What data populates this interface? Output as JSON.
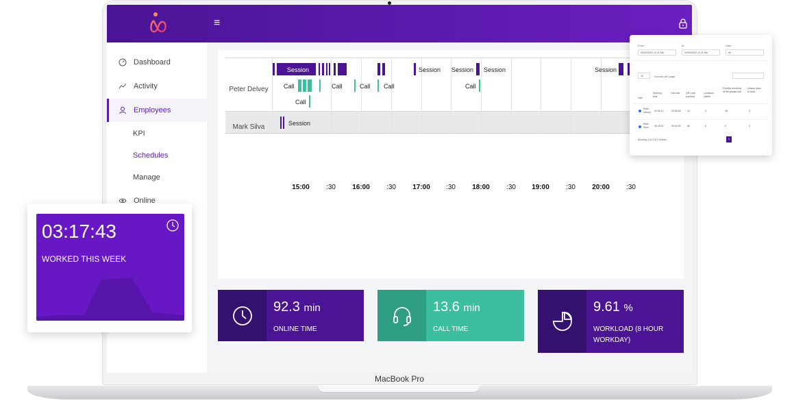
{
  "device": {
    "brand_label": "MacBook Pro"
  },
  "topbar": {
    "menu_glyph": "≡",
    "logo_icon": "logo-icon",
    "lock_icon": "lock-icon"
  },
  "sidebar": {
    "items": [
      {
        "label": "Dashboard",
        "icon": "gauge-icon"
      },
      {
        "label": "Activity",
        "icon": "trend-icon"
      },
      {
        "label": "Employees",
        "icon": "user-icon"
      },
      {
        "label": "Online",
        "icon": "eye-icon"
      }
    ],
    "sub_items": [
      {
        "label": "KPI"
      },
      {
        "label": "Schedules"
      },
      {
        "label": "Manage"
      }
    ]
  },
  "timeline": {
    "employees": [
      "Peter Delvey",
      "Mark Silva"
    ],
    "session_label": "Session",
    "call_label": "Call",
    "ticks": [
      "15:00",
      ":30",
      "16:00",
      ":30",
      "17:00",
      ":30",
      "18:00",
      ":30",
      "19:00",
      ":30",
      "20:00",
      ":30"
    ]
  },
  "stats": [
    {
      "value": "92.3",
      "unit": "min",
      "label": "ONLINE TIME",
      "icon": "clock-icon",
      "color": "#4a1495"
    },
    {
      "value": "13.6",
      "unit": "min",
      "label": "CALL TIME",
      "icon": "headset-icon",
      "color": "#3bbf9e"
    },
    {
      "value": "9.61",
      "unit": "%",
      "label": "WORKLOAD (8 HOUR WORKDAY)",
      "icon": "pie-icon",
      "color": "#4a1495"
    }
  ],
  "week_card": {
    "time": "03:17:43",
    "label": "WORKED THIS WEEK",
    "icon": "clock-icon"
  },
  "report": {
    "from_label": "From",
    "from_value": "04/02/2022 10:11 AM",
    "to_label": "to",
    "to_value": "04/09/2022 10:11 AM",
    "user_label": "User",
    "user_value": "All",
    "page_size": "10",
    "records_label": "records per page",
    "columns": [
      "User",
      "Working time",
      "Call time",
      "QR code scanned",
      "Locations visited",
      "Positive emotions of the people met",
      "Unique days of work"
    ],
    "rows": [
      {
        "user": "Peter Delvey",
        "working": "02:59:10",
        "call": "00:06:28",
        "qr": "12",
        "loc": "0",
        "pos": "28",
        "days": "5"
      },
      {
        "user": "Mark Silva",
        "working": "00:18:32",
        "call": "00:00:00",
        "qr": "65",
        "loc": "0",
        "pos": "0",
        "days": "3"
      }
    ],
    "footer": "Showing 1 to 2 of 2 entries",
    "page": "1"
  }
}
